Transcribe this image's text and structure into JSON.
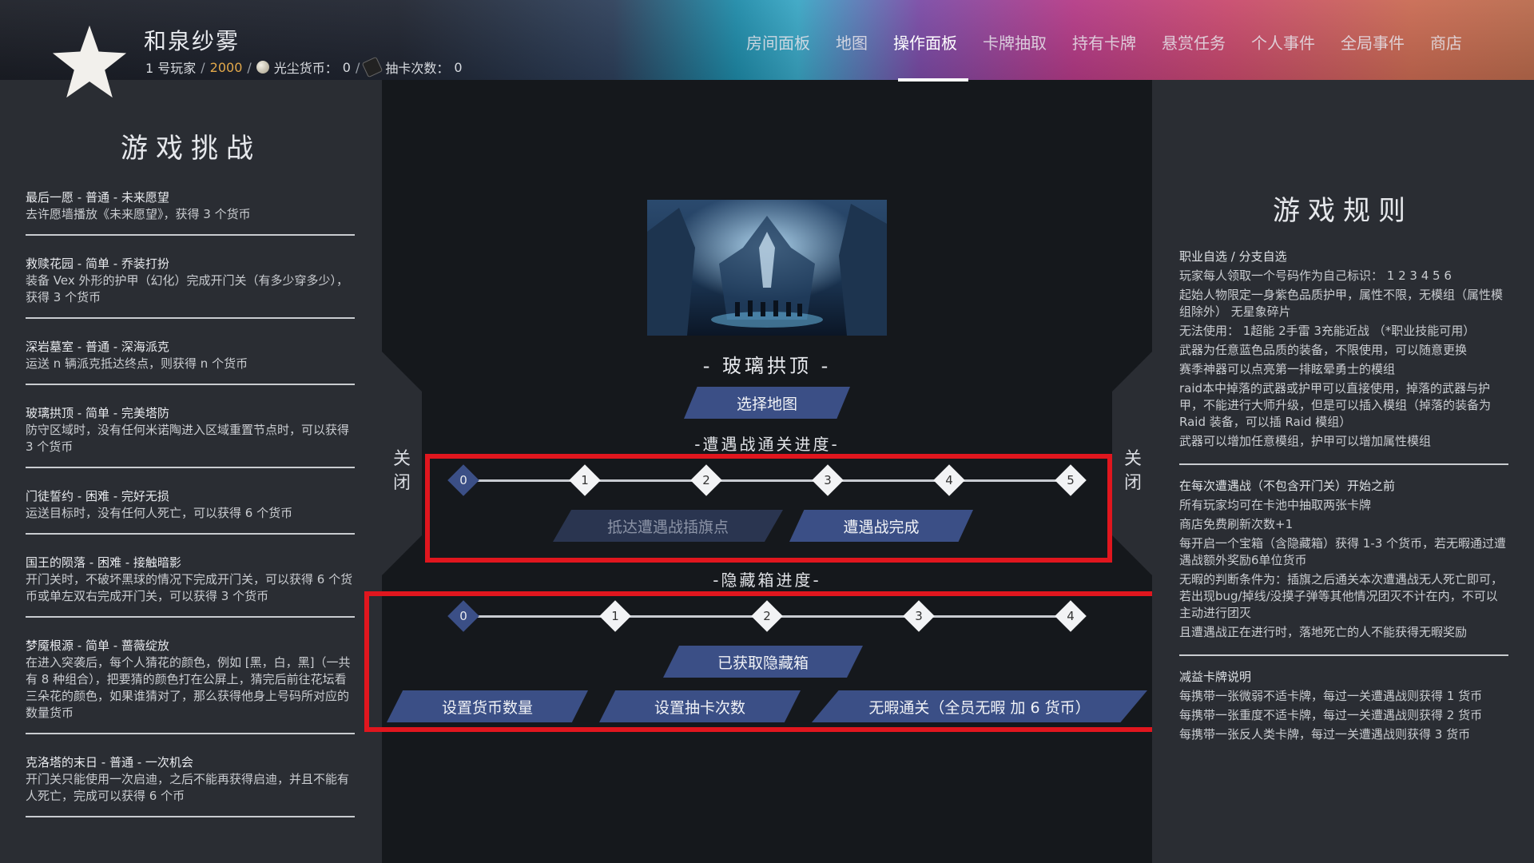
{
  "header": {
    "player_name": "和泉纱雾",
    "player_number": "1 号玩家",
    "score": "2000",
    "sep": "/",
    "currency_label": "光尘货币：",
    "currency_value": "0",
    "draws_label": "抽卡次数：",
    "draws_value": "0",
    "nav": [
      "房间面板",
      "地图",
      "操作面板",
      "卡牌抽取",
      "持有卡牌",
      "悬赏任务",
      "个人事件",
      "全局事件",
      "商店"
    ],
    "active_nav": "操作面板"
  },
  "left": {
    "title": "游戏挑战",
    "challenges": [
      {
        "title": "最后一愿 - 普通 - 未来愿望",
        "desc": "去许愿墙播放《未来愿望》，获得 3 个货币"
      },
      {
        "title": "救赎花园 - 简单 - 乔装打扮",
        "desc": "装备 Vex 外形的护甲（幻化）完成开门关（有多少穿多少），获得 3 个货币"
      },
      {
        "title": "深岩墓室 - 普通 - 深海派克",
        "desc": "运送 n 辆派克抵达终点，则获得 n 个货币"
      },
      {
        "title": "玻璃拱顶 - 简单 - 完美塔防",
        "desc": "防守区域时，没有任何米诺陶进入区域重置节点时，可以获得 3 个货币"
      },
      {
        "title": "门徒誓约 - 困难 - 完好无损",
        "desc": "运送目标时，没有任何人死亡，可以获得 6 个货币"
      },
      {
        "title": "国王的陨落 - 困难 - 接触暗影",
        "desc": "开门关时，不破坏黑球的情况下完成开门关，可以获得 6 个货币或单左双右完成开门关，可以获得 3 个货币"
      },
      {
        "title": "梦魇根源 - 简单 - 蔷薇绽放",
        "desc": "在进入突袭后，每个人猜花的颜色，例如 [黑，白，黑]（一共有 8 种组合），把要猜的颜色打在公屏上，猜完后前往花坛看三朵花的颜色，如果谁猜对了，那么获得他身上号码所对应的数量货币"
      },
      {
        "title": "克洛塔的末日 - 普通 - 一次机会",
        "desc": "开门关只能使用一次启迪，之后不能再获得启迪，并且不能有人死亡，完成可以获得 6 个币"
      }
    ]
  },
  "center": {
    "map_name": "- 玻璃拱顶 -",
    "select_map": "选择地图",
    "encounter_label": "-遭遇战通关进度-",
    "encounter_nodes": [
      "0",
      "1",
      "2",
      "3",
      "4",
      "5"
    ],
    "encounter_progress": 0,
    "flag_button": "抵达遭遇战插旗点",
    "complete_button": "遭遇战完成",
    "hidden_label": "-隐藏箱进度-",
    "hidden_nodes": [
      "0",
      "1",
      "2",
      "3",
      "4"
    ],
    "hidden_progress": 0,
    "got_hidden": "已获取隐藏箱",
    "set_currency": "设置货币数量",
    "set_draws": "设置抽卡次数",
    "flawless": "无暇通关（全员无暇 加 6 货币）",
    "close_left": [
      "关",
      "闭"
    ],
    "close_right": [
      "关",
      "闭"
    ]
  },
  "right": {
    "title": "游戏规则",
    "groups": [
      [
        "职业自选 / 分支自选",
        "玩家每人领取一个号码作为自己标识： 1 2 3 4 5 6",
        "起始人物限定一身紫色品质护甲，属性不限，无模组（属性模组除外） 无星象碎片",
        "无法使用： 1超能 2手雷 3充能近战 （*职业技能可用）",
        "武器为任意蓝色品质的装备，不限使用，可以随意更换",
        "赛季神器可以点亮第一排眩晕勇士的模组",
        "raid本中掉落的武器或护甲可以直接使用，掉落的武器与护甲，不能进行大师升级，但是可以插入模组（掉落的装备为 Raid 装备，可以插 Raid 模组）",
        "武器可以增加任意模组，护甲可以增加属性模组"
      ],
      [
        "在每次遭遇战（不包含开门关）开始之前",
        "所有玩家均可在卡池中抽取两张卡牌",
        "商店免费刷新次数+1",
        "每开启一个宝箱（含隐藏箱）获得 1-3 个货币，若无暇通过遭遇战额外奖励6单位货币",
        "无暇的判断条件为：插旗之后通关本次遭遇战无人死亡即可，若出现bug/掉线/没摸子弹等其他情况团灭不计在内，不可以主动进行团灭",
        "且遭遇战正在进行时，落地死亡的人不能获得无暇奖励"
      ],
      [
        "减益卡牌说明",
        "每携带一张微弱不适卡牌，每过一关遭遇战则获得 1 货币",
        "每携带一张重度不适卡牌，每过一关遭遇战则获得 2 货币",
        "每携带一张反人类卡牌，每过一关遭遇战则获得 3 货币"
      ]
    ]
  },
  "colors": {
    "accent": "#3b4f86",
    "highlight": "#e0161e",
    "gold": "#e2a84a"
  }
}
